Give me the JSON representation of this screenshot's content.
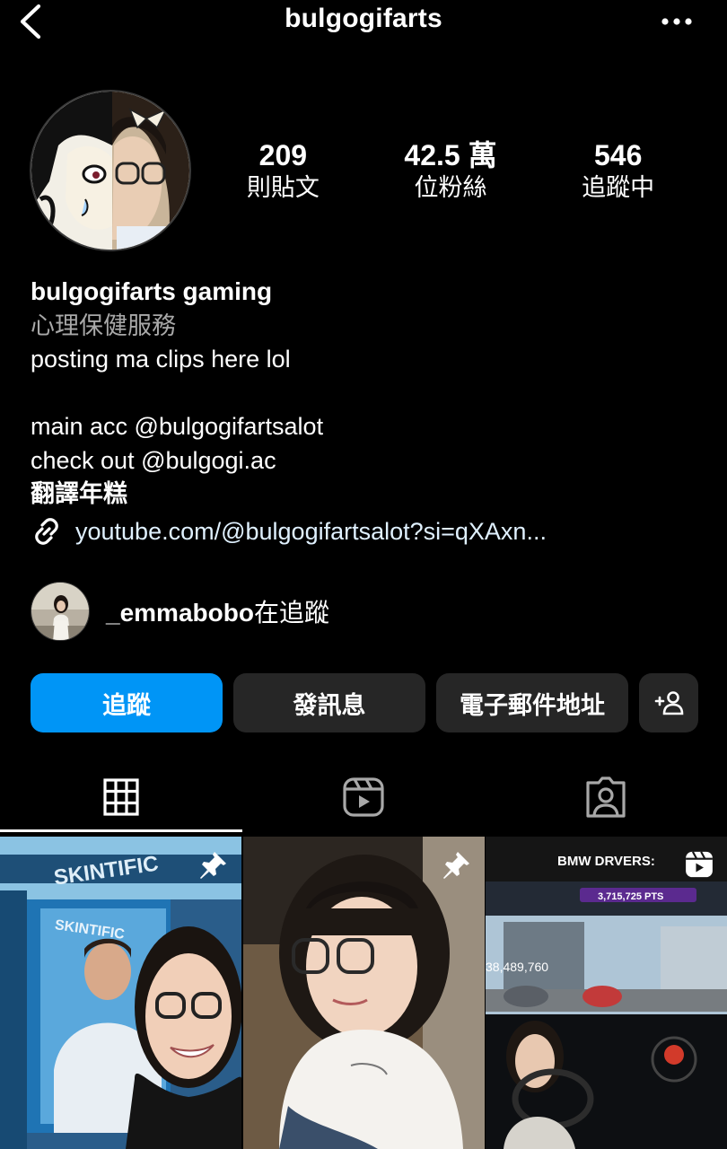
{
  "header": {
    "username": "bulgogifarts"
  },
  "stats": [
    {
      "value": "209",
      "label": "則貼文"
    },
    {
      "value": "42.5 萬",
      "label": "位粉絲"
    },
    {
      "value": "546",
      "label": "追蹤中"
    }
  ],
  "bio": {
    "name": "bulgogifarts gaming",
    "category": "心理保健服務",
    "lines": [
      "posting ma clips here lol",
      "",
      "main acc @bulgogifartsalot",
      "check out @bulgogi.ac"
    ],
    "translate": "翻譯年糕",
    "link": "youtube.com/@bulgogifartsalot?si=qXAxn..."
  },
  "followed_by": {
    "username": "_emmabobo",
    "suffix": "在追蹤"
  },
  "buttons": {
    "follow": "追蹤",
    "message": "發訊息",
    "email": "電子郵件地址",
    "add_user": "+person"
  },
  "posts": [
    {
      "type": "pinned",
      "caption": "SKINTIFIC"
    },
    {
      "type": "pinned",
      "caption": ""
    },
    {
      "type": "reel",
      "caption": "BMW DRVERS:",
      "score": "3,715,725 PTS",
      "number": "38,489,760"
    }
  ],
  "colors": {
    "background": "#000000",
    "follow_button": "#0095f6",
    "secondary_button": "#262626",
    "muted_text": "#a8a8a8"
  }
}
